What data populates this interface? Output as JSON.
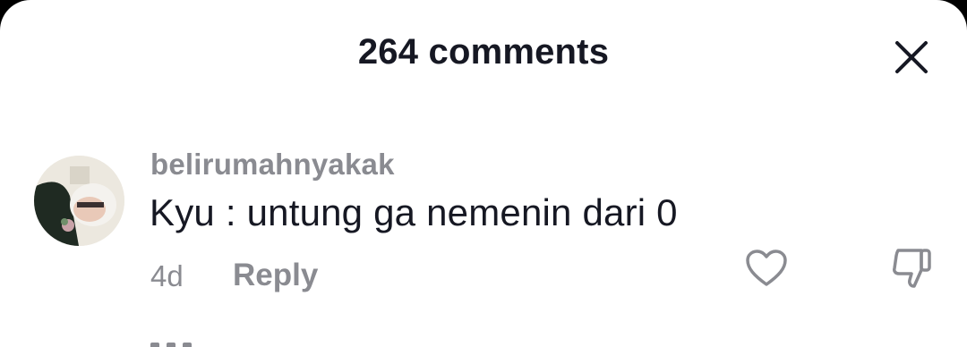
{
  "header": {
    "title": "264 comments",
    "close_icon": "close-icon"
  },
  "comment": {
    "username": "belirumahnyakak",
    "text": "Kyu : untung ga nemenin dari 0",
    "time": "4d",
    "reply_label": "Reply",
    "like_icon": "heart-outline-icon",
    "dislike_icon": "thumbs-down-icon"
  },
  "colors": {
    "background": "#ffffff",
    "text_primary": "#161823",
    "text_secondary": "#8a8b91"
  }
}
